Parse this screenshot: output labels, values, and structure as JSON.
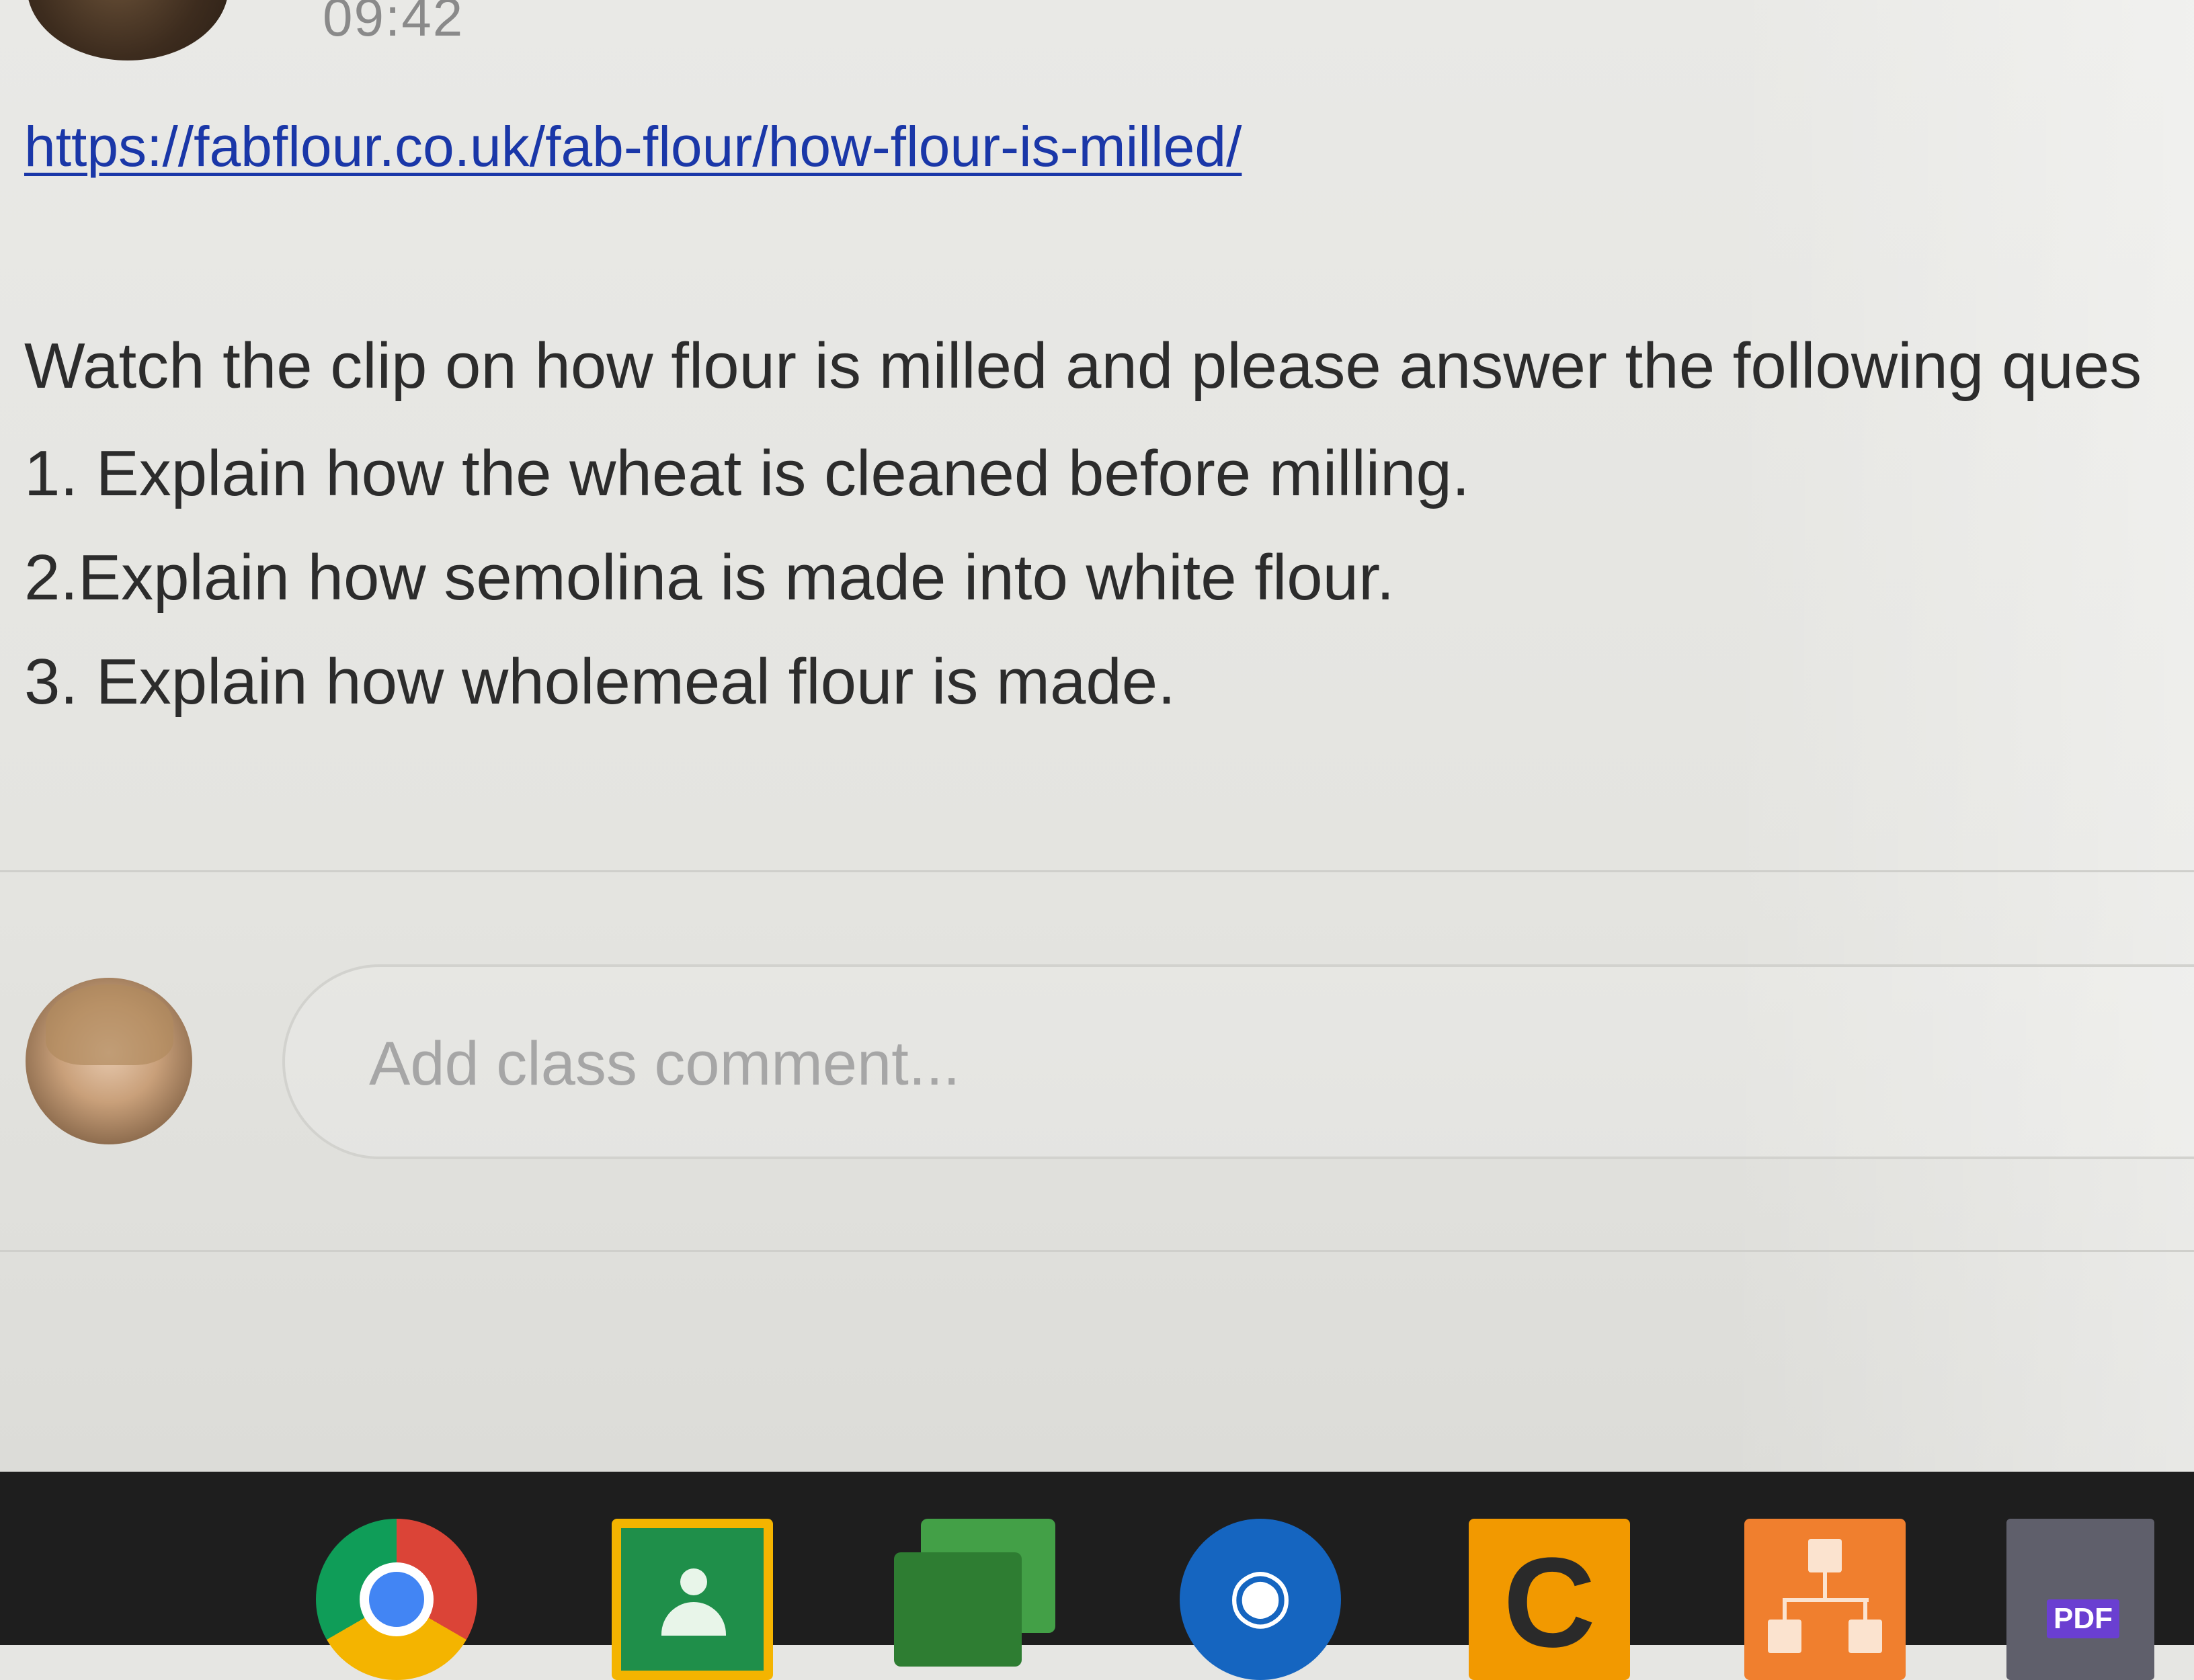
{
  "post": {
    "timestamp": "09:42",
    "link_text": "https://fabflour.co.uk/fab-flour/how-flour-is-milled/",
    "body_lines": [
      "Watch the clip on how flour is milled and please answer the following ques",
      "1. Explain how the wheat is cleaned before milling.",
      "2.Explain how semolina is made into white flour.",
      "3. Explain how wholemeal flour is made."
    ]
  },
  "comment": {
    "placeholder": "Add class comment..."
  },
  "taskbar": {
    "apps": [
      {
        "name": "Chrome",
        "icon": "chrome-icon"
      },
      {
        "name": "Classroom",
        "icon": "classroom-icon"
      },
      {
        "name": "Meet",
        "icon": "meet-icon"
      },
      {
        "name": "Viewer",
        "icon": "eye-icon",
        "glyph": "◉"
      },
      {
        "name": "C",
        "icon": "c-icon",
        "glyph": "C"
      },
      {
        "name": "Diagram",
        "icon": "diagram-icon"
      },
      {
        "name": "PDF",
        "icon": "pdf-icon",
        "label": "PDF"
      }
    ]
  },
  "colors": {
    "link": "#1a37a8",
    "text": "#2c2c2c",
    "placeholder": "#a6a6a6",
    "taskbar": "#1e1e1e"
  }
}
